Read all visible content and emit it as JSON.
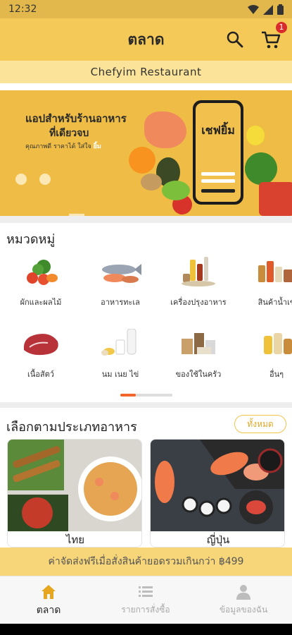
{
  "status_bar": {
    "time": "12:32",
    "icons": [
      "wifi-icon",
      "signal-icon",
      "battery-icon"
    ]
  },
  "header": {
    "title": "ตลาด",
    "cart_count": "1",
    "icons": [
      "search-icon",
      "cart-icon"
    ]
  },
  "restaurant": {
    "name": "Chefyim Restaurant"
  },
  "banner": {
    "title": "แอปสำหรับร้านอาหาร",
    "subtitle": "ที่เดียวจบ",
    "tagline_prefix": "คุณภาพดี ราคาได้ ใส่ใจ",
    "tagline_highlight": "ยิ้ม",
    "app_logo": "เชฟยิ้ม"
  },
  "categories": {
    "title": "หมวดหมู่",
    "items": [
      {
        "label": "ผักและผลไม้",
        "icon": "vegetables-icon"
      },
      {
        "label": "อาหารทะเล",
        "icon": "seafood-icon"
      },
      {
        "label": "เครื่องปรุงอาหาร",
        "icon": "seasoning-icon"
      },
      {
        "label": "สินค้าน้ำเข้",
        "icon": "imported-goods-icon"
      },
      {
        "label": "เนื้อสัตว์",
        "icon": "meat-icon"
      },
      {
        "label": "นม เนย ไข่",
        "icon": "dairy-icon"
      },
      {
        "label": "ของใช้ในครัว",
        "icon": "kitchen-supplies-icon"
      },
      {
        "label": "อื่นๆ",
        "icon": "others-icon"
      }
    ]
  },
  "cuisine": {
    "title": "เลือกตามประเภทอาหาร",
    "all_label": "ทั้งหมด",
    "items": [
      {
        "label": "ไทย"
      },
      {
        "label": "ญี่ปุ่น"
      }
    ]
  },
  "delivery_notice": "ค่าจัดส่งฟรีเมื่อสั่งสินค้ายอดรวมเกินกว่า ฿499",
  "bottom_nav": {
    "items": [
      {
        "label": "ตลาด",
        "icon": "home-icon",
        "active": true
      },
      {
        "label": "รายการสั่งซื้อ",
        "icon": "orders-list-icon",
        "active": false
      },
      {
        "label": "ข้อมูลของฉัน",
        "icon": "profile-icon",
        "active": false
      }
    ]
  },
  "colors": {
    "primary": "#f5c957",
    "accent": "#e6a620",
    "badge": "#d92b2b",
    "indicator": "#f2652b"
  }
}
